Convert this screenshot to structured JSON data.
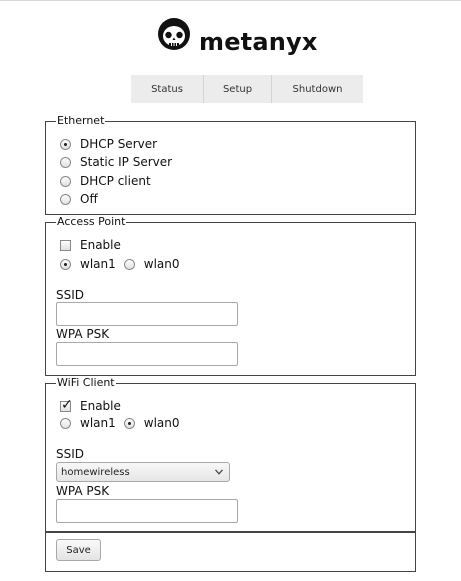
{
  "header": {
    "brand": "metanyx",
    "logo_icon": "skull-logo-icon"
  },
  "nav": {
    "items": [
      {
        "label": "Status"
      },
      {
        "label": "Setup"
      },
      {
        "label": "Shutdown"
      }
    ]
  },
  "ethernet": {
    "legend": "Ethernet",
    "options": [
      {
        "label": "DHCP Server",
        "selected": true
      },
      {
        "label": "Static IP Server",
        "selected": false
      },
      {
        "label": "DHCP client",
        "selected": false
      },
      {
        "label": "Off",
        "selected": false
      }
    ]
  },
  "access_point": {
    "legend": "Access Point",
    "enable_label": "Enable",
    "enabled": false,
    "interfaces": [
      {
        "label": "wlan1",
        "selected": true
      },
      {
        "label": "wlan0",
        "selected": false
      }
    ],
    "ssid_label": "SSID",
    "ssid_value": "",
    "psk_label": "WPA PSK",
    "psk_value": ""
  },
  "wifi_client": {
    "legend": "WiFi Client",
    "enable_label": "Enable",
    "enabled": true,
    "interfaces": [
      {
        "label": "wlan1",
        "selected": false
      },
      {
        "label": "wlan0",
        "selected": true
      }
    ],
    "ssid_label": "SSID",
    "ssid_selected": "homewireless",
    "psk_label": "WPA PSK",
    "psk_value": ""
  },
  "actions": {
    "save_label": "Save"
  }
}
